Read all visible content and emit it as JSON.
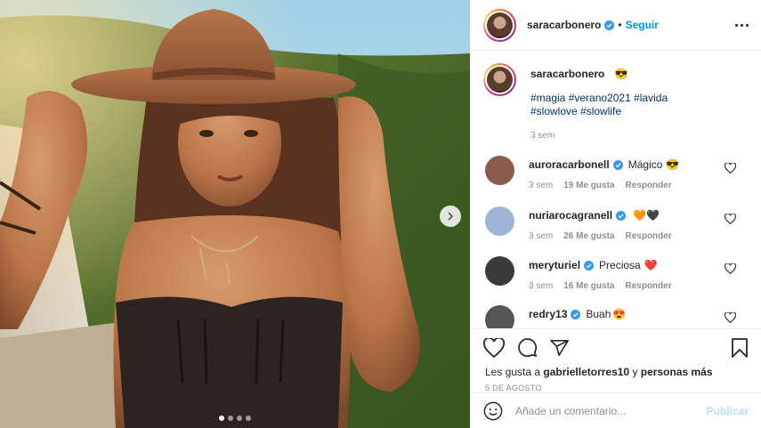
{
  "post": {
    "owner": "saracarbonero",
    "separator": "•",
    "follow_label": "Seguir"
  },
  "caption": {
    "username": "saracarbonero",
    "emoji": "😎",
    "hashtags": "#magia #verano2021 #lavida #slowlove #slowlife",
    "time": "3 sem"
  },
  "comments": [
    {
      "username": "auroracarbonell",
      "text": "Mágico",
      "emoji": "😎",
      "time": "3 sem",
      "likes": "19 Me gusta",
      "reply": "Responder",
      "avatar_color": "#8c5a4a"
    },
    {
      "username": "nuriarocagranell",
      "text": "",
      "emoji": "🧡🖤",
      "time": "3 sem",
      "likes": "26 Me gusta",
      "reply": "Responder",
      "avatar_color": "#9db4d6"
    },
    {
      "username": "meryturiel",
      "text": "Preciosa",
      "emoji": "❤️",
      "time": "3 sem",
      "likes": "16 Me gusta",
      "reply": "Responder",
      "avatar_color": "#3a3a3a"
    },
    {
      "username": "redry13",
      "text": "Buah",
      "emoji": "😍",
      "time": "",
      "likes": "",
      "reply": "",
      "avatar_color": "#555555"
    }
  ],
  "likes": {
    "prefix": "Les gusta a",
    "user": "gabrielletorres10",
    "middle": "y",
    "suffix": "personas más"
  },
  "date": "5 DE AGOSTO",
  "add_comment": {
    "placeholder": "Añade un comentario...",
    "publish_label": "Publicar"
  },
  "carousel": {
    "count": 4,
    "active": 0
  },
  "colors": {
    "link": "#0095f6",
    "hashtag": "#00376b",
    "muted": "#8e8e8e",
    "publish": "#b2dffc"
  }
}
